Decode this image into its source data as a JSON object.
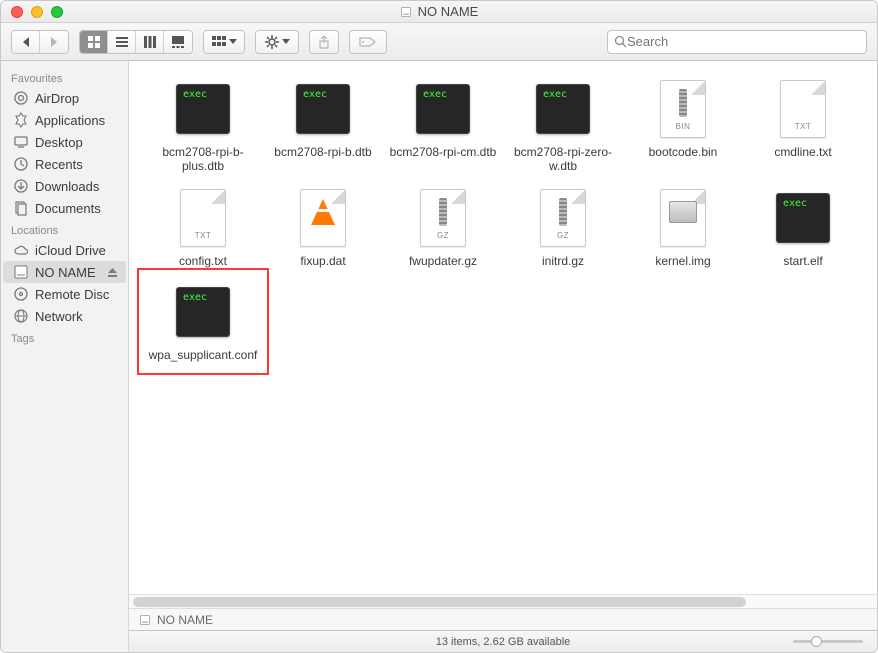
{
  "window": {
    "title": "NO NAME"
  },
  "search": {
    "placeholder": "Search"
  },
  "sidebar": {
    "sections": [
      {
        "header": "Favourites",
        "items": [
          {
            "label": "AirDrop",
            "icon": "airdrop"
          },
          {
            "label": "Applications",
            "icon": "apps"
          },
          {
            "label": "Desktop",
            "icon": "desktop"
          },
          {
            "label": "Recents",
            "icon": "recents"
          },
          {
            "label": "Downloads",
            "icon": "downloads"
          },
          {
            "label": "Documents",
            "icon": "documents"
          }
        ]
      },
      {
        "header": "Locations",
        "items": [
          {
            "label": "iCloud Drive",
            "icon": "cloud"
          },
          {
            "label": "NO NAME",
            "icon": "drive",
            "selected": true,
            "eject": true
          },
          {
            "label": "Remote Disc",
            "icon": "disc"
          },
          {
            "label": "Network",
            "icon": "globe"
          }
        ]
      },
      {
        "header": "Tags",
        "items": []
      }
    ]
  },
  "files": [
    {
      "label": "bcm2708-rpi-b-plus.dtb",
      "type": "exec"
    },
    {
      "label": "bcm2708-rpi-b.dtb",
      "type": "exec"
    },
    {
      "label": "bcm2708-rpi-cm.dtb",
      "type": "exec"
    },
    {
      "label": "bcm2708-rpi-zero-w.dtb",
      "type": "exec"
    },
    {
      "label": "bootcode.bin",
      "type": "doc",
      "badge": "BIN",
      "inner": "zip"
    },
    {
      "label": "cmdline.txt",
      "type": "doc",
      "badge": "TXT"
    },
    {
      "label": "config.txt",
      "type": "doc",
      "badge": "TXT"
    },
    {
      "label": "fixup.dat",
      "type": "doc",
      "inner": "cone"
    },
    {
      "label": "fwupdater.gz",
      "type": "doc",
      "badge": "GZ",
      "inner": "zip"
    },
    {
      "label": "initrd.gz",
      "type": "doc",
      "badge": "GZ",
      "inner": "zip"
    },
    {
      "label": "kernel.img",
      "type": "doc",
      "inner": "disk"
    },
    {
      "label": "start.elf",
      "type": "exec"
    },
    {
      "label": "wpa_supplicant.conf",
      "type": "exec",
      "highlighted": true
    }
  ],
  "pathbar": {
    "location": "NO NAME"
  },
  "status": {
    "text": "13 items, 2.62 GB available"
  }
}
